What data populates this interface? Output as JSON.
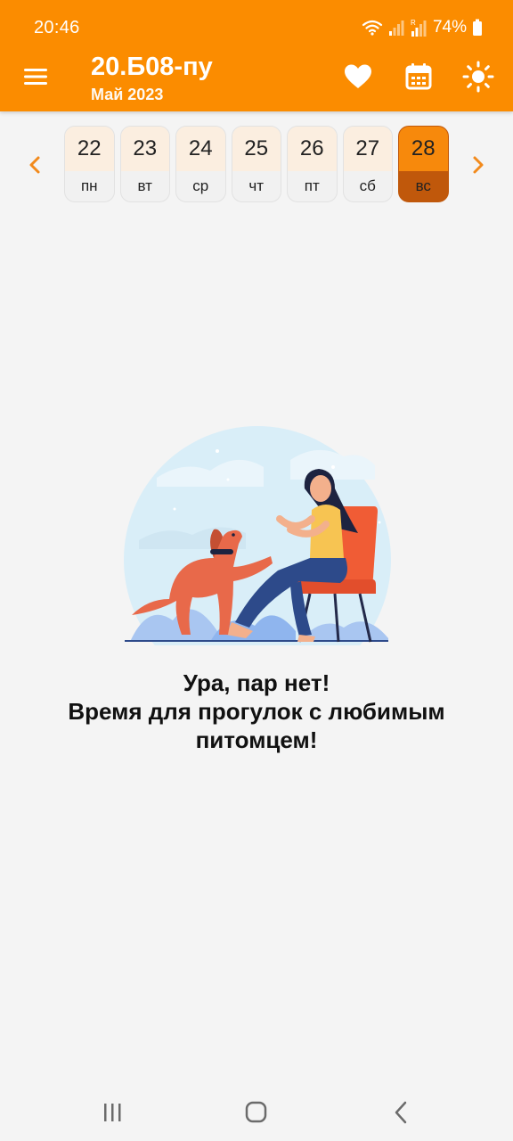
{
  "status_bar": {
    "time": "20:46",
    "battery_text": "74%",
    "icons": [
      "wifi-icon",
      "signal-icon",
      "signal-roaming-icon",
      "battery-icon"
    ]
  },
  "app_bar": {
    "title": "20.Б08-пу",
    "subtitle": "Май 2023",
    "icons": [
      "menu-icon",
      "heart-icon",
      "calendar-icon",
      "sun-icon"
    ]
  },
  "week": {
    "prev_icon": "chevron-left-icon",
    "next_icon": "chevron-right-icon",
    "days": [
      {
        "num": "22",
        "dow": "пн",
        "selected": false
      },
      {
        "num": "23",
        "dow": "вт",
        "selected": false
      },
      {
        "num": "24",
        "dow": "ср",
        "selected": false
      },
      {
        "num": "25",
        "dow": "чт",
        "selected": false
      },
      {
        "num": "26",
        "dow": "пт",
        "selected": false
      },
      {
        "num": "27",
        "dow": "сб",
        "selected": false
      },
      {
        "num": "28",
        "dow": "вс",
        "selected": true
      }
    ]
  },
  "empty_state": {
    "line1": "Ура, пар нет!",
    "line2": "Время для прогулок с любимым питомцем!"
  },
  "nav_bar": {
    "icons": [
      "recent-apps-icon",
      "home-icon",
      "back-icon"
    ]
  },
  "colors": {
    "accent": "#fb8c00",
    "selected_day_top": "#f7890c",
    "selected_day_bottom": "#c0580b",
    "day_top": "#fbeee0",
    "background": "#f4f4f4"
  }
}
